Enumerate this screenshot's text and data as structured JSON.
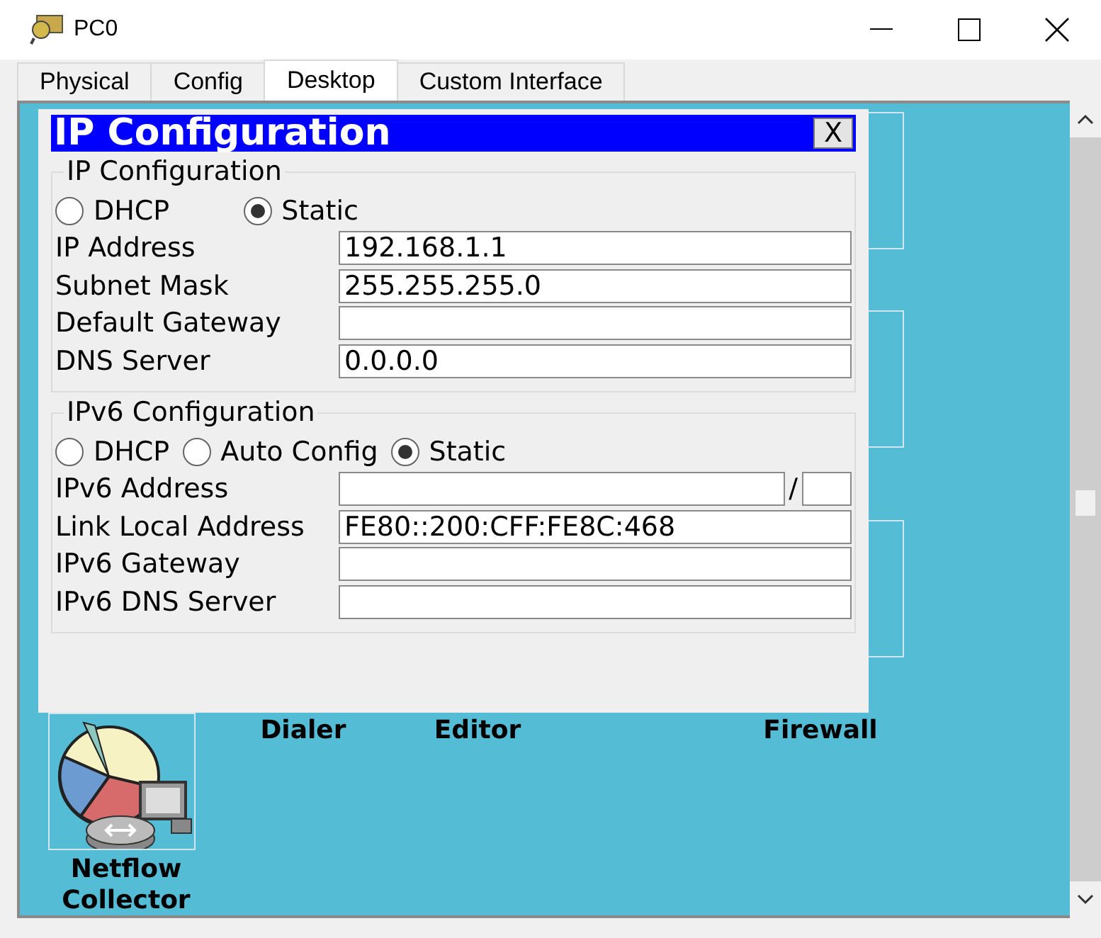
{
  "window": {
    "title": "PC0"
  },
  "tabs": [
    {
      "label": "Physical",
      "selected": false
    },
    {
      "label": "Config",
      "selected": false
    },
    {
      "label": "Desktop",
      "selected": true
    },
    {
      "label": "Custom Interface",
      "selected": false
    }
  ],
  "desktop": {
    "apps": [
      {
        "label": "Dialer"
      },
      {
        "label": "Editor"
      },
      {
        "label": "Firewall"
      },
      {
        "label": "Netflow Collector"
      }
    ]
  },
  "dialog": {
    "title": "IP Configuration",
    "close": "X",
    "groups": [
      {
        "title": "IP Configuration",
        "modes": [
          {
            "label": "DHCP",
            "selected": false
          },
          {
            "label": "Static",
            "selected": true
          }
        ],
        "fields": [
          {
            "kind": "text",
            "label": "IP Address",
            "value": "192.168.1.1"
          },
          {
            "kind": "text",
            "label": "Subnet Mask",
            "value": "255.255.255.0"
          },
          {
            "kind": "text",
            "label": "Default Gateway"
          },
          {
            "kind": "text",
            "label": "DNS Server",
            "value": "0.0.0.0"
          }
        ]
      },
      {
        "title": "IPv6 Configuration",
        "modes": [
          {
            "label": "DHCP",
            "selected": false
          },
          {
            "label": "Auto Config",
            "selected": false
          },
          {
            "label": "Static",
            "selected": true
          }
        ],
        "fields": [
          {
            "kind": "prefixed",
            "label": "IPv6 Address",
            "separator": "/"
          },
          {
            "kind": "text",
            "label": "Link Local Address",
            "value": "FE80::200:CFF:FE8C:468"
          },
          {
            "kind": "text",
            "label": "IPv6 Gateway"
          },
          {
            "kind": "text",
            "label": "IPv6 DNS Server"
          }
        ]
      }
    ]
  }
}
